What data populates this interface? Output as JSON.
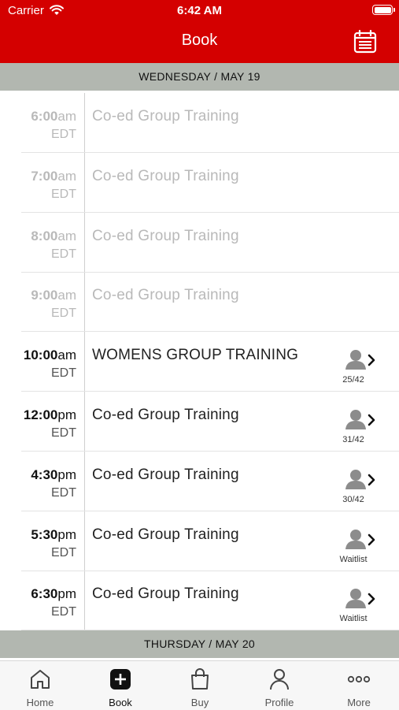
{
  "status": {
    "carrier": "Carrier",
    "time": "6:42 AM"
  },
  "nav": {
    "title": "Book"
  },
  "dates": {
    "first": "WEDNESDAY / MAY 19",
    "second": "THURSDAY / MAY 20"
  },
  "sessions": [
    {
      "hm": "6:00",
      "ap": "am",
      "tz": "EDT",
      "name": "Co-ed Group Training",
      "state": "past"
    },
    {
      "hm": "7:00",
      "ap": "am",
      "tz": "EDT",
      "name": "Co-ed Group Training",
      "state": "past"
    },
    {
      "hm": "8:00",
      "ap": "am",
      "tz": "EDT",
      "name": "Co-ed Group Training",
      "state": "past"
    },
    {
      "hm": "9:00",
      "ap": "am",
      "tz": "EDT",
      "name": "Co-ed Group Training",
      "state": "past"
    },
    {
      "hm": "10:00",
      "ap": "am",
      "tz": "EDT",
      "name": "WOMENS GROUP TRAINING",
      "state": "open",
      "spots": "25/42"
    },
    {
      "hm": "12:00",
      "ap": "pm",
      "tz": "EDT",
      "name": "Co-ed Group Training",
      "state": "open",
      "spots": "31/42"
    },
    {
      "hm": "4:30",
      "ap": "pm",
      "tz": "EDT",
      "name": "Co-ed Group Training",
      "state": "open",
      "spots": "30/42"
    },
    {
      "hm": "5:30",
      "ap": "pm",
      "tz": "EDT",
      "name": "Co-ed Group Training",
      "state": "open",
      "spots": "Waitlist"
    },
    {
      "hm": "6:30",
      "ap": "pm",
      "tz": "EDT",
      "name": "Co-ed Group Training",
      "state": "open",
      "spots": "Waitlist"
    }
  ],
  "tabs": [
    {
      "label": "Home",
      "icon": "home-icon"
    },
    {
      "label": "Book",
      "icon": "plus-square-icon"
    },
    {
      "label": "Buy",
      "icon": "shopping-bag-icon"
    },
    {
      "label": "Profile",
      "icon": "person-icon"
    },
    {
      "label": "More",
      "icon": "more-dots-icon"
    }
  ],
  "colors": {
    "brand": "#d40000",
    "header_bg": "#b2b7b0"
  }
}
